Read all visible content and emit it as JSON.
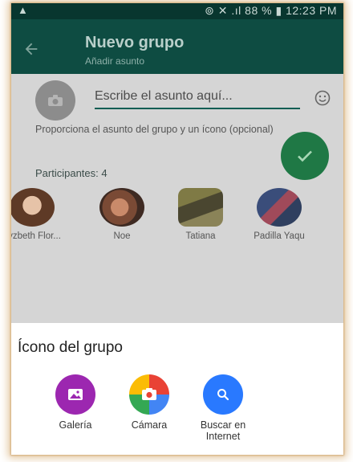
{
  "status_bar": {
    "battery": "88 %",
    "time": "12:23 PM",
    "text": "⊚ ✕ .ıl 88 % ▮ 12:23 PM"
  },
  "header": {
    "title": "Nuevo grupo",
    "subtitle": "Añadir asunto"
  },
  "subject": {
    "placeholder": "Escribe el asunto aquí..."
  },
  "hint": "Proporciona el asunto del grupo y un ícono (opcional)",
  "participants": {
    "label": "Participantes: 4",
    "members": [
      {
        "name": "Lyzbeth Flor..."
      },
      {
        "name": "Noe"
      },
      {
        "name": "Tatiana"
      },
      {
        "name": "Padilla Yaqu"
      }
    ]
  },
  "sheet": {
    "title": "Ícono del grupo",
    "options": [
      {
        "label": "Galería",
        "color": "#9c27b0"
      },
      {
        "label": "Cámara",
        "color": "#f4b400"
      },
      {
        "label": "Buscar en Internet",
        "label_line1": "Buscar en",
        "label_line2": "Internet",
        "color": "#2979ff"
      }
    ]
  },
  "colors": {
    "app_bar": "#0e4c42",
    "accent_green": "#1f7845",
    "scrim": "#d5d5d5"
  }
}
